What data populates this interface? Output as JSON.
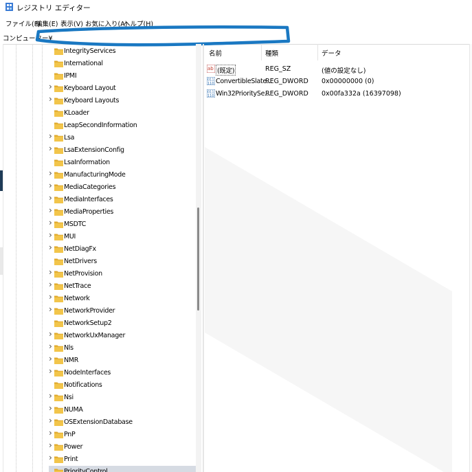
{
  "window": {
    "title": "レジストリ エディター",
    "icon": "regedit-icon"
  },
  "menu": [
    {
      "label": "ファイル(F)"
    },
    {
      "label": "編集(E)"
    },
    {
      "label": "表示(V)"
    },
    {
      "label": "お気に入り(A)"
    },
    {
      "label": "ヘルプ(H)"
    }
  ],
  "address": {
    "label": "コンピューター¥",
    "redaction_color": "#1a78c2"
  },
  "tree": {
    "nodes": [
      {
        "label": "IntegrityServices",
        "expandable": false
      },
      {
        "label": "International",
        "expandable": false
      },
      {
        "label": "IPMI",
        "expandable": false
      },
      {
        "label": "Keyboard Layout",
        "expandable": true
      },
      {
        "label": "Keyboard Layouts",
        "expandable": true
      },
      {
        "label": "KLoader",
        "expandable": false
      },
      {
        "label": "LeapSecondInformation",
        "expandable": false
      },
      {
        "label": "Lsa",
        "expandable": true
      },
      {
        "label": "LsaExtensionConfig",
        "expandable": true
      },
      {
        "label": "LsaInformation",
        "expandable": false
      },
      {
        "label": "ManufacturingMode",
        "expandable": true
      },
      {
        "label": "MediaCategories",
        "expandable": true
      },
      {
        "label": "MediaInterfaces",
        "expandable": true
      },
      {
        "label": "MediaProperties",
        "expandable": true
      },
      {
        "label": "MSDTC",
        "expandable": true
      },
      {
        "label": "MUI",
        "expandable": true
      },
      {
        "label": "NetDiagFx",
        "expandable": true
      },
      {
        "label": "NetDrivers",
        "expandable": false
      },
      {
        "label": "NetProvision",
        "expandable": true
      },
      {
        "label": "NetTrace",
        "expandable": true
      },
      {
        "label": "Network",
        "expandable": true
      },
      {
        "label": "NetworkProvider",
        "expandable": true
      },
      {
        "label": "NetworkSetup2",
        "expandable": false
      },
      {
        "label": "NetworkUxManager",
        "expandable": true
      },
      {
        "label": "Nls",
        "expandable": true
      },
      {
        "label": "NMR",
        "expandable": true
      },
      {
        "label": "NodeInterfaces",
        "expandable": true
      },
      {
        "label": "Notifications",
        "expandable": false
      },
      {
        "label": "Nsi",
        "expandable": true
      },
      {
        "label": "NUMA",
        "expandable": true
      },
      {
        "label": "OSExtensionDatabase",
        "expandable": true
      },
      {
        "label": "PnP",
        "expandable": true
      },
      {
        "label": "Power",
        "expandable": true
      },
      {
        "label": "Print",
        "expandable": true
      },
      {
        "label": "PriorityControl",
        "expandable": false,
        "selected": true
      }
    ]
  },
  "values_pane": {
    "columns": {
      "name": "名前",
      "type": "種類",
      "data": "データ"
    },
    "rows": [
      {
        "icon": "string-value-icon",
        "name": "(既定)",
        "type": "REG_SZ",
        "data": "(値の設定なし)"
      },
      {
        "icon": "dword-value-icon",
        "name": "ConvertibleSlate...",
        "type": "REG_DWORD",
        "data": "0x00000000 (0)"
      },
      {
        "icon": "dword-value-icon",
        "name": "Win32PrioritySe...",
        "type": "REG_DWORD",
        "data": "0x00fa332a (16397098)"
      }
    ]
  },
  "colors": {
    "folder": "#f2c54b",
    "selected": "#d6dbe3",
    "accent": "#1a78c2"
  }
}
